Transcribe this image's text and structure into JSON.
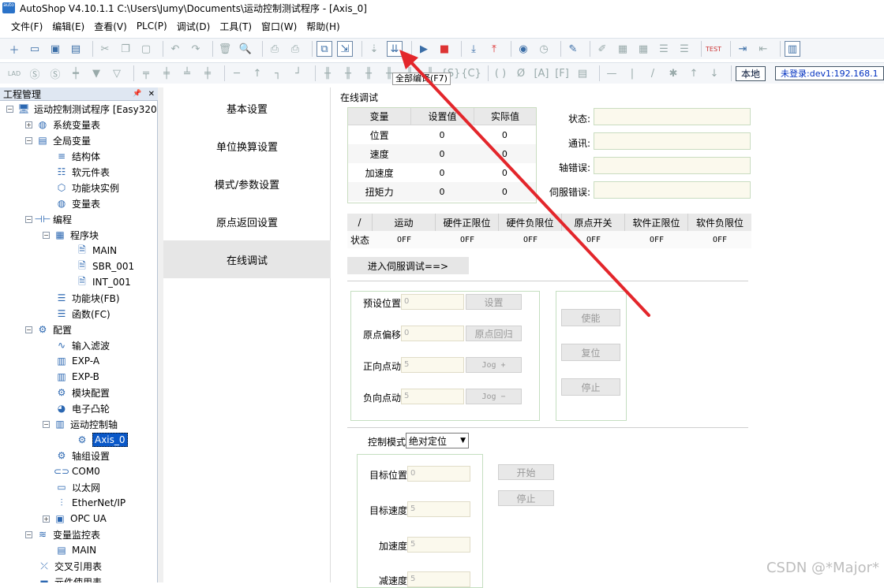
{
  "window": {
    "app_logo": "auto",
    "title": "AutoShop V4.10.1.1  C:\\Users\\Jumy\\Documents\\运动控制测试程序 - [Axis_0]"
  },
  "menu": [
    "文件(F)",
    "编辑(E)",
    "查看(V)",
    "PLC(P)",
    "调试(D)",
    "工具(T)",
    "窗口(W)",
    "帮助(H)"
  ],
  "toolbar": {
    "tooltip": "全部编译(F7)",
    "local_label": "本地",
    "login_status": "未登录:dev1:192.168.1"
  },
  "left_panel": {
    "title": "工程管理",
    "pin": "📌",
    "close": "✕",
    "tree": [
      {
        "label": "运动控制测试程序 [Easy320",
        "icon": "computer-icon"
      },
      {
        "label": "系统变量表",
        "icon": "globe-icon"
      },
      {
        "label": "全局变量",
        "icon": "table-icon"
      },
      {
        "label": "结构体",
        "icon": "struct-icon"
      },
      {
        "label": "软元件表",
        "icon": "list-icon"
      },
      {
        "label": "功能块实例",
        "icon": "cube-icon"
      },
      {
        "label": "变量表",
        "icon": "globe-icon"
      },
      {
        "label": "编程",
        "icon": "program-icon"
      },
      {
        "label": "程序块",
        "icon": "block-icon"
      },
      {
        "label": "MAIN",
        "icon": "doc-m-icon"
      },
      {
        "label": "SBR_001",
        "icon": "doc-s-icon"
      },
      {
        "label": "INT_001",
        "icon": "doc-i-icon"
      },
      {
        "label": "功能块(FB)",
        "icon": "fb-icon"
      },
      {
        "label": "函数(FC)",
        "icon": "fc-icon"
      },
      {
        "label": "配置",
        "icon": "config-icon"
      },
      {
        "label": "输入滤波",
        "icon": "wave-icon"
      },
      {
        "label": "EXP-A",
        "icon": "module-icon"
      },
      {
        "label": "EXP-B",
        "icon": "module-icon"
      },
      {
        "label": "模块配置",
        "icon": "gear-list-icon"
      },
      {
        "label": "电子凸轮",
        "icon": "cam-icon"
      },
      {
        "label": "运动控制轴",
        "icon": "axis-icon"
      },
      {
        "label": "Axis_0",
        "icon": "axis-item-icon"
      },
      {
        "label": "轴组设置",
        "icon": "gear-icon"
      },
      {
        "label": "COM0",
        "icon": "serial-icon"
      },
      {
        "label": "以太网",
        "icon": "network-icon"
      },
      {
        "label": "EtherNet/IP",
        "icon": "ethernet-icon"
      },
      {
        "label": "OPC UA",
        "icon": "opc-icon"
      },
      {
        "label": "变量监控表",
        "icon": "monitor-icon"
      },
      {
        "label": "MAIN",
        "icon": "table-icon"
      },
      {
        "label": "交叉引用表",
        "icon": "cross-icon"
      },
      {
        "label": "元件使用表",
        "icon": "usage-icon"
      }
    ]
  },
  "nav": [
    "基本设置",
    "单位换算设置",
    "模式/参数设置",
    "原点返回设置",
    "在线调试"
  ],
  "online": {
    "section_title": "在线调试",
    "var_table": {
      "headers": [
        "变量",
        "设置值",
        "实际值"
      ],
      "rows": [
        [
          "位置",
          "0",
          "0"
        ],
        [
          "速度",
          "0",
          "0"
        ],
        [
          "加速度",
          "0",
          "0"
        ],
        [
          "扭矩力",
          "0",
          "0"
        ]
      ]
    },
    "status_labels": [
      "状态:",
      "通讯:",
      "轴错误:",
      "伺服错误:"
    ],
    "status_table": {
      "headers": [
        "/",
        "运动",
        "硬件正限位",
        "硬件负限位",
        "原点开关",
        "软件正限位",
        "软件负限位"
      ],
      "row": [
        "状态",
        "OFF",
        "OFF",
        "OFF",
        "OFF",
        "OFF",
        "OFF"
      ]
    },
    "servo_button": "进入伺服调试==>",
    "jog": [
      {
        "label": "预设位置",
        "value": "0",
        "button": "设置"
      },
      {
        "label": "原点偏移",
        "value": "0",
        "button": "原点回归"
      },
      {
        "label": "正向点动",
        "value": "5",
        "button": "Jog +"
      },
      {
        "label": "负向点动",
        "value": "5",
        "button": "Jog −"
      }
    ],
    "side_buttons": [
      "使能",
      "复位",
      "停止"
    ],
    "control_mode_label": "控制模式",
    "control_mode_value": "绝对定位",
    "targets": [
      {
        "label": "目标位置",
        "value": "0"
      },
      {
        "label": "目标速度",
        "value": "5"
      },
      {
        "label": "加速度",
        "value": "5"
      },
      {
        "label": "减速度",
        "value": "5"
      }
    ],
    "start_button": "开始",
    "stop_button": "停止"
  },
  "watermark": "CSDN @*Major*",
  "annotation_color": "#e3262b"
}
